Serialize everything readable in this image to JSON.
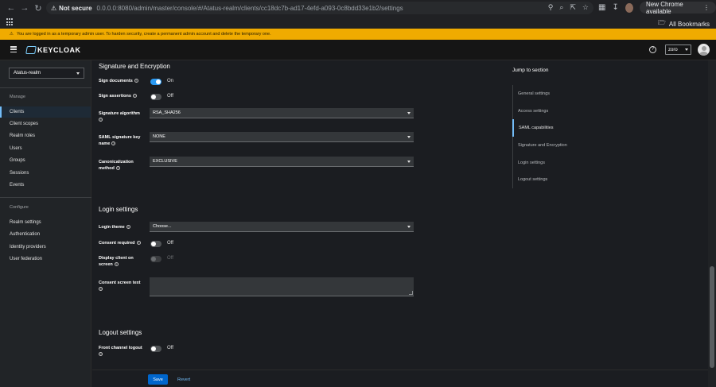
{
  "browser": {
    "not_secure": "Not secure",
    "url": "0.0.0.0:8080/admin/master/console/#/Atatus-realm/clients/cc18dc7b-ad17-4efd-a093-0c8bdd33e1b2/settings",
    "new_chrome": "New Chrome available",
    "all_bookmarks": "All Bookmarks"
  },
  "warning": {
    "text": "You are logged in as a temporary admin user. To harden security, create a permanent admin account and delete the temporary one."
  },
  "header": {
    "logo": "KEYCLOAK",
    "user": "zoro"
  },
  "sidebar": {
    "realm": "Atatus-realm",
    "manage_label": "Manage",
    "manage_items": [
      "Clients",
      "Client scopes",
      "Realm roles",
      "Users",
      "Groups",
      "Sessions",
      "Events"
    ],
    "configure_label": "Configure",
    "configure_items": [
      "Realm settings",
      "Authentication",
      "Identity providers",
      "User federation"
    ]
  },
  "signature": {
    "title": "Signature and Encryption",
    "sign_documents_label": "Sign documents",
    "sign_documents_state": "On",
    "sign_assertions_label": "Sign assertions",
    "sign_assertions_state": "Off",
    "signature_algorithm_label": "Signature algorithm",
    "signature_algorithm_value": "RSA_SHA256",
    "saml_key_name_label_1": "SAML signature key",
    "saml_key_name_label_2": "name",
    "saml_key_name_value": "NONE",
    "canonicalization_label_1": "Canonicalization",
    "canonicalization_label_2": "method",
    "canonicalization_value": "EXCLUSIVE"
  },
  "login": {
    "title": "Login settings",
    "login_theme_label": "Login theme",
    "login_theme_placeholder": "Choose...",
    "consent_required_label": "Consent required",
    "consent_required_state": "Off",
    "display_client_label_1": "Display client on",
    "display_client_label_2": "screen",
    "display_client_state": "Off",
    "consent_text_label": "Consent screen text"
  },
  "logout": {
    "title": "Logout settings",
    "front_channel_label": "Front channel logout",
    "front_channel_state": "Off"
  },
  "jump": {
    "title": "Jump to section",
    "items": [
      "General settings",
      "Access settings",
      "SAML capabilities",
      "Signature and Encryption",
      "Login settings",
      "Logout settings"
    ],
    "active_index": 2
  },
  "actions": {
    "save": "Save",
    "revert": "Revert"
  },
  "colors": {
    "accent": "#2b9af3",
    "warning": "#f0ab00",
    "primary_button": "#0066cc",
    "link": "#73bcf7"
  }
}
